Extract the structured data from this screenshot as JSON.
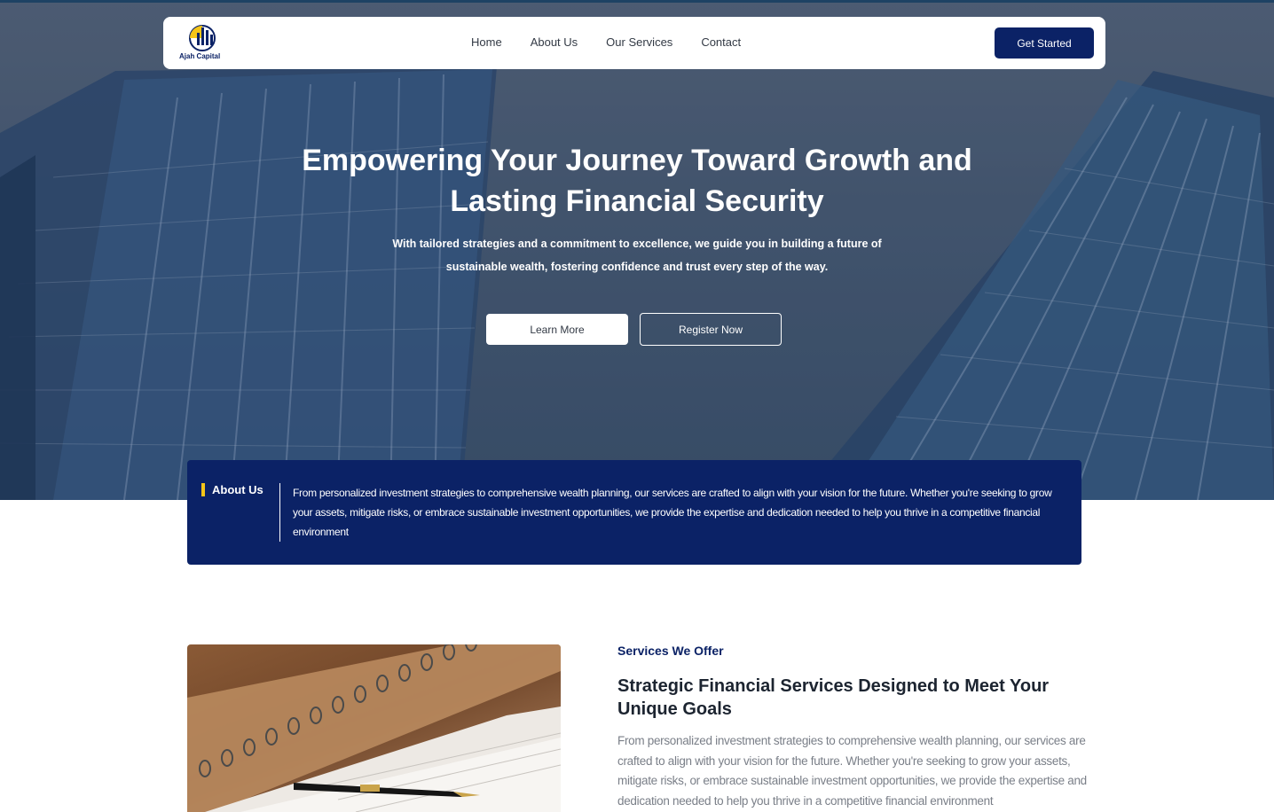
{
  "brand": {
    "name": "Ajah Capital",
    "primary_color": "#0b2266",
    "accent_color": "#f5c518"
  },
  "nav": {
    "links": [
      "Home",
      "About Us",
      "Our Services",
      "Contact"
    ],
    "cta_label": "Get Started"
  },
  "hero": {
    "title": "Empowering Your Journey Toward Growth and Lasting Financial Security",
    "subtitle": "With tailored strategies and a commitment to excellence, we guide you in building a future of sustainable wealth, fostering confidence and trust every step of the way.",
    "primary_button": "Learn More",
    "secondary_button": "Register Now"
  },
  "about": {
    "label": "About Us",
    "text": "From personalized investment strategies to comprehensive wealth planning, our services are crafted to align with your vision for the future. Whether you're seeking to grow your assets, mitigate risks, or embrace sustainable investment opportunities, we provide the expertise and dedication needed to help you thrive in a competitive financial environment"
  },
  "services": {
    "tag": "Services We Offer",
    "title": "Strategic Financial Services Designed to Meet Your Unique Goals",
    "text": "From personalized investment strategies to comprehensive wealth planning, our services are crafted to align with your vision for the future. Whether you're seeking to grow your assets, mitigate risks, or embrace sustainable investment opportunities, we provide the expertise and dedication needed to help you thrive in a competitive financial environment"
  }
}
